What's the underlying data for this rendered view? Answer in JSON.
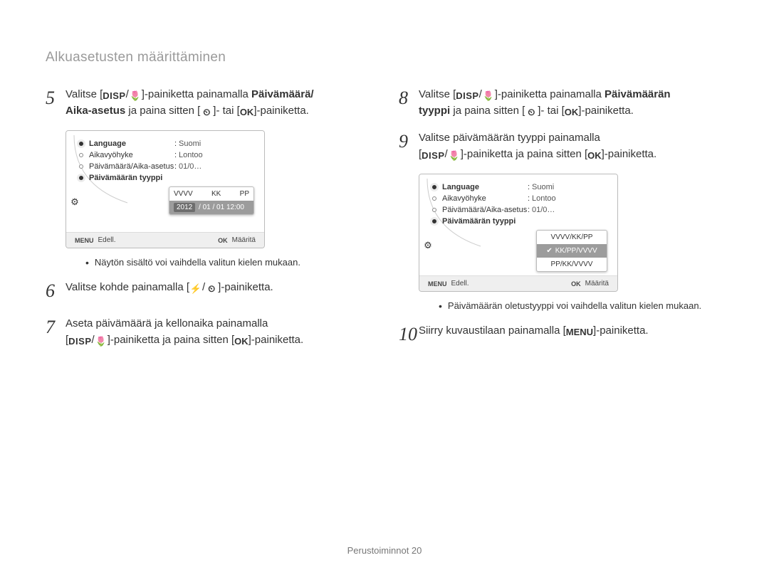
{
  "page_title": "Alkuasetusten määrittäminen",
  "footer": "Perustoiminnot  20",
  "icons": {
    "disp": "DISP",
    "macro": "🌷",
    "clock": "⏲",
    "ok": "OK",
    "flash": "⚡",
    "menu": "MENU",
    "gear": "⚙",
    "check": "✔"
  },
  "left": {
    "step5": {
      "num": "5",
      "t1": "Valitse [",
      "t2": "/",
      "t3": "]-painiketta painamalla ",
      "bold1": "Päivämäärä/",
      "bold2": "Aika-asetus",
      "t4": " ja paina sitten [",
      "t5": "]- tai [",
      "t6": "]-painiketta."
    },
    "ui1": {
      "rows": [
        {
          "label": "Language",
          "value": "Suomi",
          "bold": true
        },
        {
          "label": "Aikavyöhyke",
          "value": "Lontoo"
        },
        {
          "label": "Päivämäärä/Aika-asetus",
          "value": "01/0…"
        },
        {
          "label": "Päivämäärän tyyppi",
          "value": ""
        }
      ],
      "dd_head": {
        "y": "VVVV",
        "m": "KK",
        "d": "PP"
      },
      "dd_value": {
        "year": "2012",
        "rest": " / 01 / 01 12:00"
      },
      "footer_left_tag": "MENU",
      "footer_left": "Edell.",
      "footer_right_tag": "OK",
      "footer_right": "Määritä"
    },
    "note1": "Näytön sisältö voi vaihdella valitun kielen mukaan.",
    "step6": {
      "num": "6",
      "t1": "Valitse kohde painamalla [",
      "t2": "/",
      "t3": "]-painiketta."
    },
    "step7": {
      "num": "7",
      "t1": "Aseta päivämäärä ja kellonaika painamalla ",
      "t2": "[",
      "t3": "/",
      "t4": "]-painiketta ja paina sitten [",
      "t5": "]-painiketta."
    }
  },
  "right": {
    "step8": {
      "num": "8",
      "t1": "Valitse [",
      "t2": "/",
      "t3": "]-painiketta painamalla ",
      "bold1": "Päivämäärän",
      "bold2": "tyyppi",
      "t4": " ja paina sitten [",
      "t5": "]- tai [",
      "t6": "]-painiketta."
    },
    "step9": {
      "num": "9",
      "t1": "Valitse päivämäärän tyyppi painamalla ",
      "t2": "[",
      "t3": "/",
      "t4": "]-painiketta ja paina sitten [",
      "t5": "]-painiketta."
    },
    "ui2": {
      "rows": [
        {
          "label": "Language",
          "value": "Suomi",
          "bold": true
        },
        {
          "label": "Aikavyöhyke",
          "value": "Lontoo"
        },
        {
          "label": "Päivämäärä/Aika-asetus",
          "value": "01/0…"
        },
        {
          "label": "Päivämäärän tyyppi",
          "value": ""
        }
      ],
      "options": [
        "VVVV/KK/PP",
        "KK/PP/VVVV",
        "PP/KK/VVVV"
      ],
      "selected_index": 1,
      "footer_left_tag": "MENU",
      "footer_left": "Edell.",
      "footer_right_tag": "OK",
      "footer_right": "Määritä"
    },
    "note2": "Päivämäärän oletustyyppi voi vaihdella valitun kielen mukaan.",
    "step10": {
      "num": "10",
      "t1": "Siirry kuvaustilaan painamalla [",
      "t2": "]-painiketta."
    }
  }
}
